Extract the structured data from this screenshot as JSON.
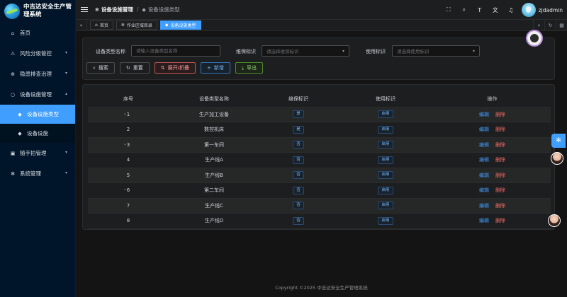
{
  "sidebar": {
    "title": "中吉达安全生产管理系统",
    "items": [
      {
        "label": "首页",
        "icon": "home-icon"
      },
      {
        "label": "风险分级管控",
        "icon": "warning-icon"
      },
      {
        "label": "隐患排查治理",
        "icon": "crosshair-icon"
      },
      {
        "label": "设备设施管理",
        "icon": "settings-icon"
      },
      {
        "label": "设备设施类型",
        "icon": "cube-icon"
      },
      {
        "label": "设备设施",
        "icon": "cube-icon"
      },
      {
        "label": "随手拍管理",
        "icon": "camera-icon"
      },
      {
        "label": "系统管理",
        "icon": "gear-icon"
      }
    ]
  },
  "header": {
    "breadcrumb": [
      "设备设施管理",
      "设备设施类型"
    ],
    "username": "zjdadmin"
  },
  "tabs": [
    "首页",
    "作业区域目录",
    "设备设施类型"
  ],
  "search": {
    "type_name_label": "设备类型名称",
    "type_name_placeholder": "请输入设备类型名称",
    "maint_label": "维保标识",
    "maint_placeholder": "请选择维保标识",
    "usage_label": "使用标识",
    "usage_placeholder": "请选择使用标识",
    "buttons": [
      "搜索",
      "重置",
      "展开/折叠",
      "新增",
      "导出"
    ]
  },
  "table": {
    "headers": [
      "序号",
      "设备类型名称",
      "维保标识",
      "使用标识",
      "操作"
    ],
    "rows": [
      {
        "no": "1",
        "name": "生产加工设备",
        "maint": "是",
        "usage": "启用",
        "expandable": true
      },
      {
        "no": "2",
        "name": "数控机床",
        "maint": "是",
        "usage": "启用",
        "expandable": false
      },
      {
        "no": "3",
        "name": "第一车间",
        "maint": "否",
        "usage": "启用",
        "expandable": true
      },
      {
        "no": "4",
        "name": "生产线A",
        "maint": "否",
        "usage": "启用",
        "expandable": false
      },
      {
        "no": "5",
        "name": "生产线B",
        "maint": "否",
        "usage": "启用",
        "expandable": false
      },
      {
        "no": "6",
        "name": "第二车间",
        "maint": "否",
        "usage": "启用",
        "expandable": true
      },
      {
        "no": "7",
        "name": "生产线C",
        "maint": "否",
        "usage": "启用",
        "expandable": false
      },
      {
        "no": "8",
        "name": "生产线D",
        "maint": "否",
        "usage": "启用",
        "expandable": false
      }
    ],
    "edit_label": "编辑",
    "delete_label": "删除"
  },
  "footer": "Copyright ©2025 中吉达安全生产管理系统",
  "colors": {
    "accent": "#409eff",
    "danger": "#f56c6c",
    "sidebar_bg": "#001529"
  }
}
